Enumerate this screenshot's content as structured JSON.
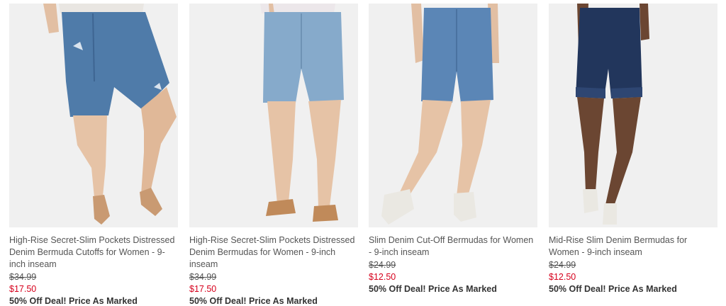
{
  "products": [
    {
      "title": "High-Rise Secret-Slim Pockets Distressed Denim Bermuda Cutoffs for Women - 9-inch inseam",
      "original_price": "$34.99",
      "sale_price": "$17.50",
      "deal": "50% Off Deal! Price As Marked",
      "denim_color": "#4f7ba9",
      "shoe": "tan-slingback-flats"
    },
    {
      "title": "High-Rise Secret-Slim Pockets Distressed Denim Bermudas for Women - 9-inch inseam",
      "original_price": "$34.99",
      "sale_price": "$17.50",
      "deal": "50% Off Deal! Price As Marked",
      "denim_color": "#86aacb",
      "shoe": "tan-slide-sandals"
    },
    {
      "title": "Slim Denim Cut-Off Bermudas for Women - 9-inch inseam",
      "original_price": "$24.99",
      "sale_price": "$12.50",
      "deal": "50% Off Deal! Price As Marked",
      "denim_color": "#5b86b6",
      "shoe": "white-slip-on-sneakers"
    },
    {
      "title": "Mid-Rise Slim Denim Bermudas for Women - 9-inch inseam",
      "original_price": "$24.99",
      "sale_price": "$12.50",
      "deal": "50% Off Deal! Price As Marked",
      "denim_color": "#22365c",
      "shoe": "white-slip-on-sneakers"
    }
  ],
  "colors": {
    "sale_red": "#d6001c",
    "text_gray": "#555555",
    "photo_bg": "#efefef"
  }
}
